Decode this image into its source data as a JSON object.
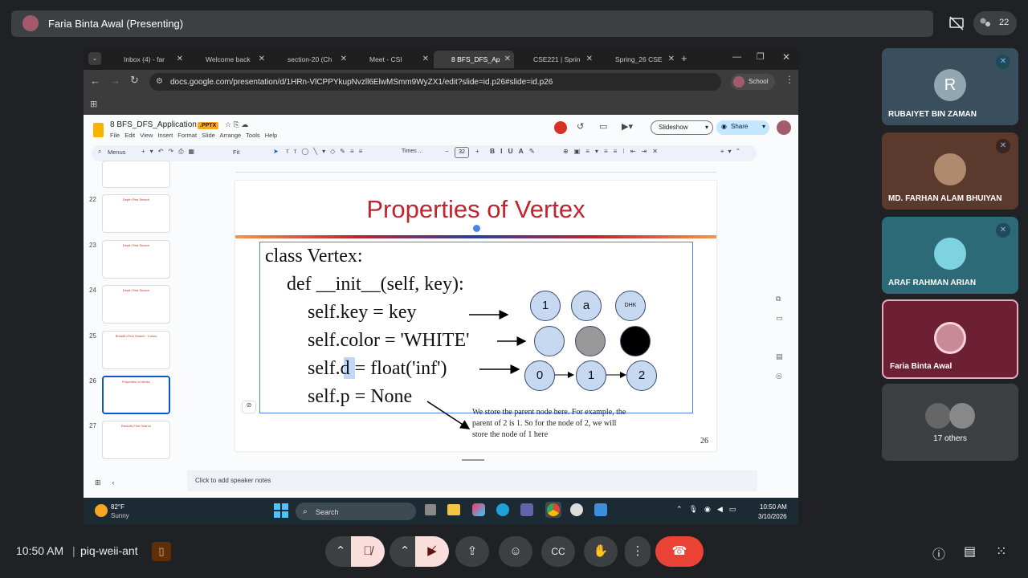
{
  "meet": {
    "presenter_label": "Faria Binta Awal (Presenting)",
    "people_count": "22",
    "time": "10:50 AM",
    "separator": "|",
    "meeting_code": "piq-weii-ant"
  },
  "browser": {
    "tabs": [
      {
        "label": "Inbox (4) - far",
        "color": "#ea4335"
      },
      {
        "label": "Welcome back",
        "color": "#e37400"
      },
      {
        "label": "section-20 (Ch",
        "color": "#e37400"
      },
      {
        "label": "Meet - CSI",
        "color": "#00897b"
      },
      {
        "label": "8 BFS_DFS_Ap",
        "color": "#f4b400"
      },
      {
        "label": "CSE221 | Sprin",
        "color": "#0f9d58"
      },
      {
        "label": "Spring_26 CSE",
        "color": "#0f9d58"
      }
    ],
    "url": "docs.google.com/presentation/d/1HRn-VlCPPYkupNvzll6ElwMSmm9WyZX1/edit?slide=id.p26#slide=id.p26",
    "profile_label": "School"
  },
  "slides_app": {
    "doc_title": "8 BFS_DFS_Application",
    "badge": ".PPTX",
    "menu": [
      "File",
      "Edit",
      "View",
      "Insert",
      "Format",
      "Slide",
      "Arrange",
      "Tools",
      "Help"
    ],
    "menus_label": "Menus",
    "zoom": "Fit",
    "font": "Times ...",
    "font_size": "32",
    "slideshow_label": "Slideshow",
    "share_label": "Share",
    "speaker_notes_placeholder": "Click to add speaker notes"
  },
  "filmstrip": [
    {
      "num": "",
      "title": ""
    },
    {
      "num": "22",
      "title": "Depth First Search"
    },
    {
      "num": "23",
      "title": "Depth First Search"
    },
    {
      "num": "24",
      "title": "Depth First Search"
    },
    {
      "num": "25",
      "title": "Breadth-First Search : Colors"
    },
    {
      "num": "26",
      "title": "Properties of Vertex"
    },
    {
      "num": "27",
      "title": "Breadth-First Search"
    }
  ],
  "slide": {
    "title": "Properties of Vertex",
    "code_lines": [
      "class Vertex:",
      "def __init__(self, key):",
      "self.key = key",
      "self.color = 'WHITE'",
      "self.d = float('inf')",
      "self.p = None"
    ],
    "row1_labels": [
      "1",
      "a",
      "DHK"
    ],
    "row2_colors": [
      "#c6d9f1",
      "#999999",
      "#000000"
    ],
    "row3_labels": [
      "0",
      "1",
      "2"
    ],
    "note": "We store the parent node here. For example, the parent of 2 is 1. So for the node of 2, we will store the node of 1 here",
    "slide_number": "26"
  },
  "taskbar": {
    "temperature": "82°F",
    "weather": "Sunny",
    "search": "Search",
    "time": "10:50 AM",
    "date": "3/10/2026"
  },
  "participants": [
    {
      "name": "RUBAIYET BIN ZAMAN",
      "initial": "R",
      "bg": "#3a4f5d",
      "avatar_color": "#93a7b3"
    },
    {
      "name": "MD. FARHAN ALAM BHUIYAN",
      "initial": "",
      "bg": "#5b3a2e",
      "avatar_color": "#b08a6e"
    },
    {
      "name": "ARAF RAHMAN ARIAN",
      "initial": "",
      "bg": "#2d6a78",
      "avatar_color": "#7dd3e0"
    },
    {
      "name": "Faria Binta Awal",
      "initial": "",
      "bg": "#6d1f33",
      "avatar_color": "#c98a97"
    },
    {
      "name": "17 others",
      "initial": "",
      "bg": "#3c4043",
      "avatar_color": "#666"
    }
  ]
}
